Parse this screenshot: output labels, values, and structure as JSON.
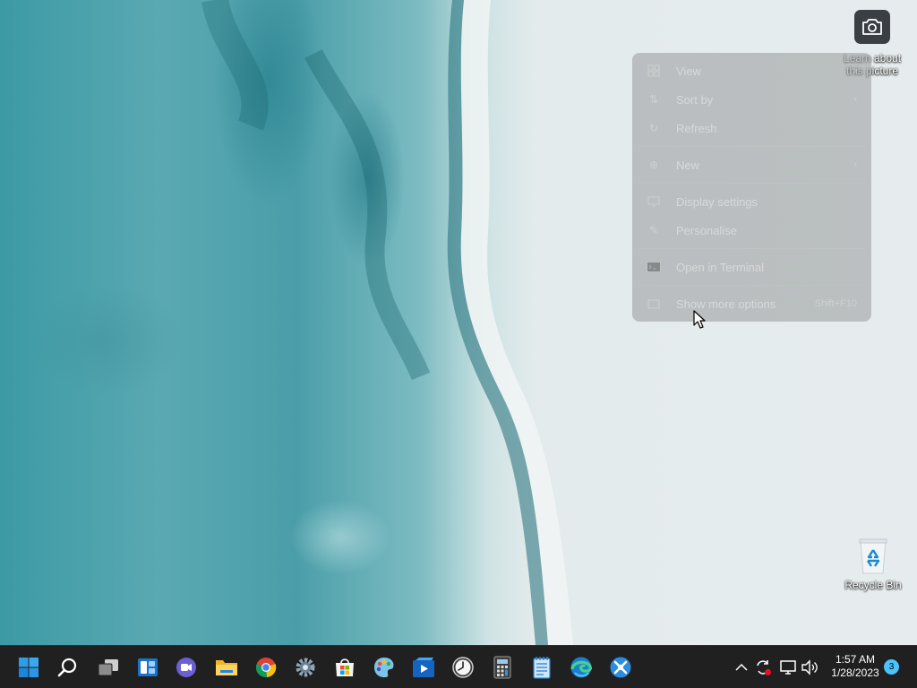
{
  "desktop": {
    "learn_about_picture": {
      "label_line1": "Learn about",
      "label_line2": "this picture",
      "icon": "camera-icon"
    },
    "recycle_bin": {
      "label": "Recycle Bin",
      "icon": "recycle-bin-icon"
    }
  },
  "context_menu": {
    "items": [
      {
        "label": "View",
        "icon": "view-grid-icon",
        "has_submenu": true
      },
      {
        "label": "Sort by",
        "icon": "sort-icon",
        "has_submenu": true
      },
      {
        "label": "Refresh",
        "icon": "refresh-icon",
        "has_submenu": false
      },
      {
        "label": "New",
        "icon": "new-plus-icon",
        "has_submenu": true
      },
      {
        "label": "Display settings",
        "icon": "display-icon",
        "has_submenu": false
      },
      {
        "label": "Personalise",
        "icon": "brush-icon",
        "has_submenu": false
      },
      {
        "label": "Open in Terminal",
        "icon": "terminal-icon",
        "has_submenu": false
      },
      {
        "label": "Show more options",
        "icon": "more-options-icon",
        "shortcut": "Shift+F10"
      }
    ]
  },
  "taskbar": {
    "apps": [
      {
        "name": "start",
        "icon": "windows-start-icon"
      },
      {
        "name": "search",
        "icon": "search-icon"
      },
      {
        "name": "task-view",
        "icon": "task-view-icon"
      },
      {
        "name": "widgets",
        "icon": "widgets-icon"
      },
      {
        "name": "teams-chat",
        "icon": "chat-icon"
      },
      {
        "name": "file-explorer",
        "icon": "folder-icon"
      },
      {
        "name": "chrome",
        "icon": "chrome-icon"
      },
      {
        "name": "settings",
        "icon": "gear-icon"
      },
      {
        "name": "store",
        "icon": "store-icon"
      },
      {
        "name": "paint",
        "icon": "paint-palette-icon"
      },
      {
        "name": "media-player",
        "icon": "media-player-icon"
      },
      {
        "name": "clock",
        "icon": "clock-icon"
      },
      {
        "name": "calculator",
        "icon": "calculator-icon"
      },
      {
        "name": "notepad",
        "icon": "notepad-icon"
      },
      {
        "name": "edge",
        "icon": "edge-icon"
      },
      {
        "name": "snipping-tool",
        "icon": "snipping-tool-icon"
      }
    ],
    "tray": {
      "chevron_icon": "chevron-up-icon",
      "sync_icon": "sync-icon",
      "network_icon": "network-icon",
      "volume_icon": "volume-icon"
    },
    "clock": {
      "time": "1:57 AM",
      "date": "1/28/2023"
    },
    "notifications": {
      "count": "3"
    }
  },
  "colors": {
    "taskbar_bg": "#202020",
    "accent": "#0078d4",
    "badge": "#4cc2ff"
  }
}
